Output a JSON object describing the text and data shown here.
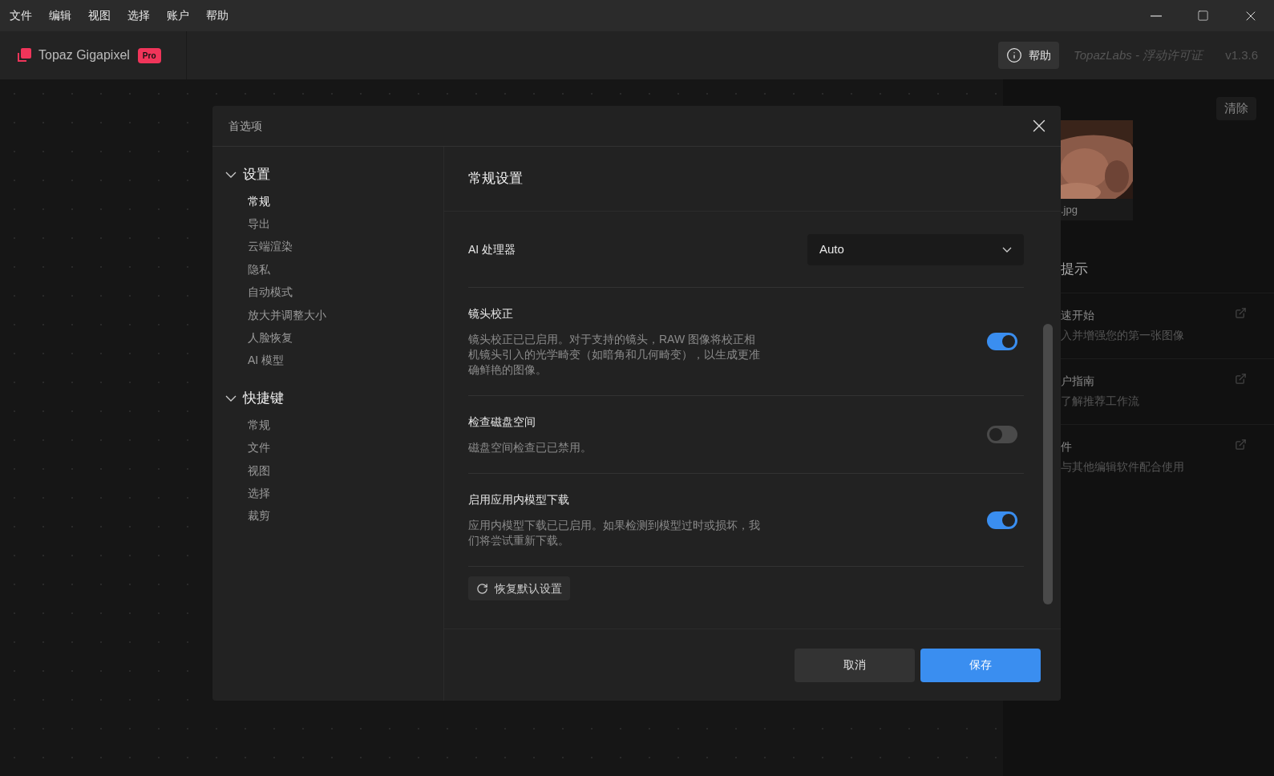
{
  "menu": [
    "文件",
    "编辑",
    "视图",
    "选择",
    "账户",
    "帮助"
  ],
  "header": {
    "app_name": "Topaz Gigapixel",
    "badge": "Pro",
    "help": "帮助",
    "license": "TopazLabs - 浮动许可证",
    "version": "v1.3.6"
  },
  "right_panel": {
    "clear": "清除",
    "thumbnail": {
      "kind": "picture",
      "caption": ".jpg"
    },
    "tips_title": "提示",
    "tips": [
      {
        "title": "速开始",
        "subtitle": "入并增强您的第一张图像"
      },
      {
        "title": "户指南",
        "subtitle": "了解推荐工作流"
      },
      {
        "title": "件",
        "subtitle": "与其他编辑软件配合使用"
      }
    ]
  },
  "dialog": {
    "title": "首选项",
    "nav": [
      {
        "label": "设置",
        "expanded": true,
        "children": [
          {
            "label": "常规",
            "selected": true
          },
          {
            "label": "导出",
            "selected": false
          },
          {
            "label": "云端渲染",
            "selected": false
          },
          {
            "label": "隐私",
            "selected": false
          },
          {
            "label": "自动模式",
            "selected": false
          },
          {
            "label": "放大并调整大小",
            "selected": false
          },
          {
            "label": "人脸恢复",
            "selected": false
          },
          {
            "label": "AI 模型",
            "selected": false
          }
        ]
      },
      {
        "label": "快捷键",
        "expanded": true,
        "children": [
          {
            "label": "常规",
            "selected": false
          },
          {
            "label": "文件",
            "selected": false
          },
          {
            "label": "视图",
            "selected": false
          },
          {
            "label": "选择",
            "selected": false
          },
          {
            "label": "裁剪",
            "selected": false
          }
        ]
      }
    ],
    "section_title": "常规设置",
    "processor": {
      "label": "AI 处理器",
      "value": "Auto"
    },
    "settings": [
      {
        "title": "镜头校正",
        "description": "镜头校正已已启用。对于支持的镜头，RAW 图像将校正相机镜头引入的光学畸变（如暗角和几何畸变），以生成更准确鲜艳的图像。",
        "on": true
      },
      {
        "title": "检查磁盘空间",
        "description": "磁盘空间检查已已禁用。",
        "on": false
      },
      {
        "title": "启用应用内模型下载",
        "description": "应用内模型下载已已启用。如果检测到模型过时或损坏，我们将尝试重新下载。",
        "on": true
      }
    ],
    "reset": "恢复默认设置",
    "buttons": [
      {
        "label": "取消",
        "kind": "secondary"
      },
      {
        "label": "保存",
        "kind": "primary"
      }
    ]
  }
}
